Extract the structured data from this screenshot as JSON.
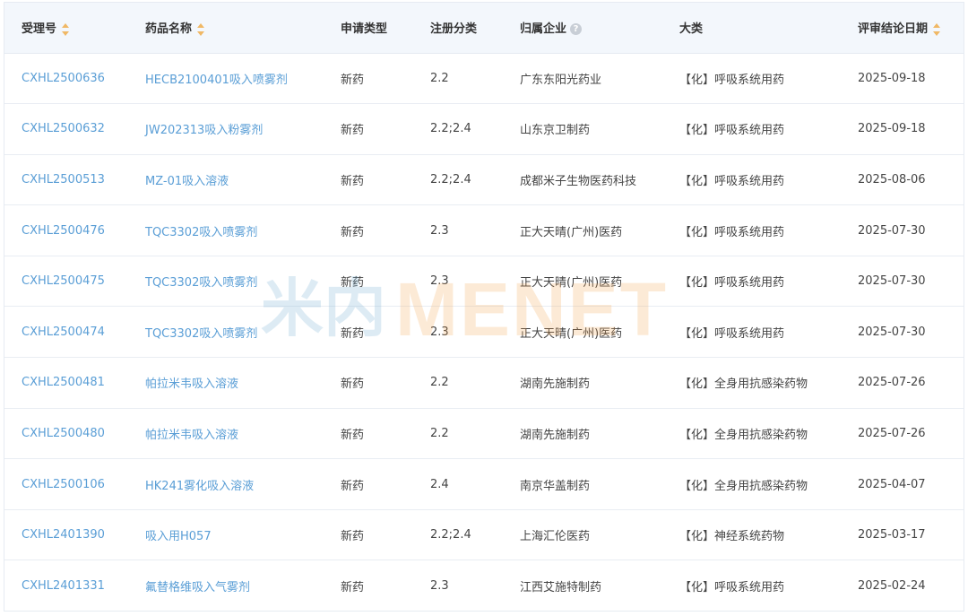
{
  "table": {
    "columns": [
      {
        "label": "受理号",
        "sortable": true,
        "help": false
      },
      {
        "label": "药品名称",
        "sortable": true,
        "help": false
      },
      {
        "label": "申请类型",
        "sortable": false,
        "help": false
      },
      {
        "label": "注册分类",
        "sortable": false,
        "help": false
      },
      {
        "label": "归属企业",
        "sortable": false,
        "help": true
      },
      {
        "label": "大类",
        "sortable": false,
        "help": false
      },
      {
        "label": "评审结论日期",
        "sortable": true,
        "help": false
      }
    ],
    "help_glyph": "?",
    "rows": [
      [
        "CXHL2500636",
        "HECB2100401吸入喷雾剂",
        "新药",
        "2.2",
        "广东东阳光药业",
        "【化】呼吸系统用药",
        "2025-09-18"
      ],
      [
        "CXHL2500632",
        "JW202313吸入粉雾剂",
        "新药",
        "2.2;2.4",
        "山东京卫制药",
        "【化】呼吸系统用药",
        "2025-09-18"
      ],
      [
        "CXHL2500513",
        "MZ-01吸入溶液",
        "新药",
        "2.2;2.4",
        "成都米子生物医药科技",
        "【化】呼吸系统用药",
        "2025-08-06"
      ],
      [
        "CXHL2500476",
        "TQC3302吸入喷雾剂",
        "新药",
        "2.3",
        "正大天晴(广州)医药",
        "【化】呼吸系统用药",
        "2025-07-30"
      ],
      [
        "CXHL2500475",
        "TQC3302吸入喷雾剂",
        "新药",
        "2.3",
        "正大天晴(广州)医药",
        "【化】呼吸系统用药",
        "2025-07-30"
      ],
      [
        "CXHL2500474",
        "TQC3302吸入喷雾剂",
        "新药",
        "2.3",
        "正大天晴(广州)医药",
        "【化】呼吸系统用药",
        "2025-07-30"
      ],
      [
        "CXHL2500481",
        "帕拉米韦吸入溶液",
        "新药",
        "2.2",
        "湖南先施制药",
        "【化】全身用抗感染药物",
        "2025-07-26"
      ],
      [
        "CXHL2500480",
        "帕拉米韦吸入溶液",
        "新药",
        "2.2",
        "湖南先施制药",
        "【化】全身用抗感染药物",
        "2025-07-26"
      ],
      [
        "CXHL2500106",
        "HK241雾化吸入溶液",
        "新药",
        "2.4",
        "南京华盖制药",
        "【化】全身用抗感染药物",
        "2025-04-07"
      ],
      [
        "CXHL2401390",
        "吸入用H057",
        "新药",
        "2.2;2.4",
        "上海汇伦医药",
        "【化】神经系统药物",
        "2025-03-17"
      ],
      [
        "CXHL2401331",
        "氟替格维吸入气雾剂",
        "新药",
        "2.3",
        "江西艾施特制药",
        "【化】呼吸系统用药",
        "2025-02-24"
      ]
    ]
  },
  "watermark": {
    "logo_text": "米内",
    "brand_text": "MENET"
  },
  "colors": {
    "link": "#5a9ed6",
    "sort_icon": "#f0b865",
    "header_bg": "#f3f7fc",
    "watermark_orange": "#f6a24a",
    "watermark_blue": "#6aa7cf"
  }
}
